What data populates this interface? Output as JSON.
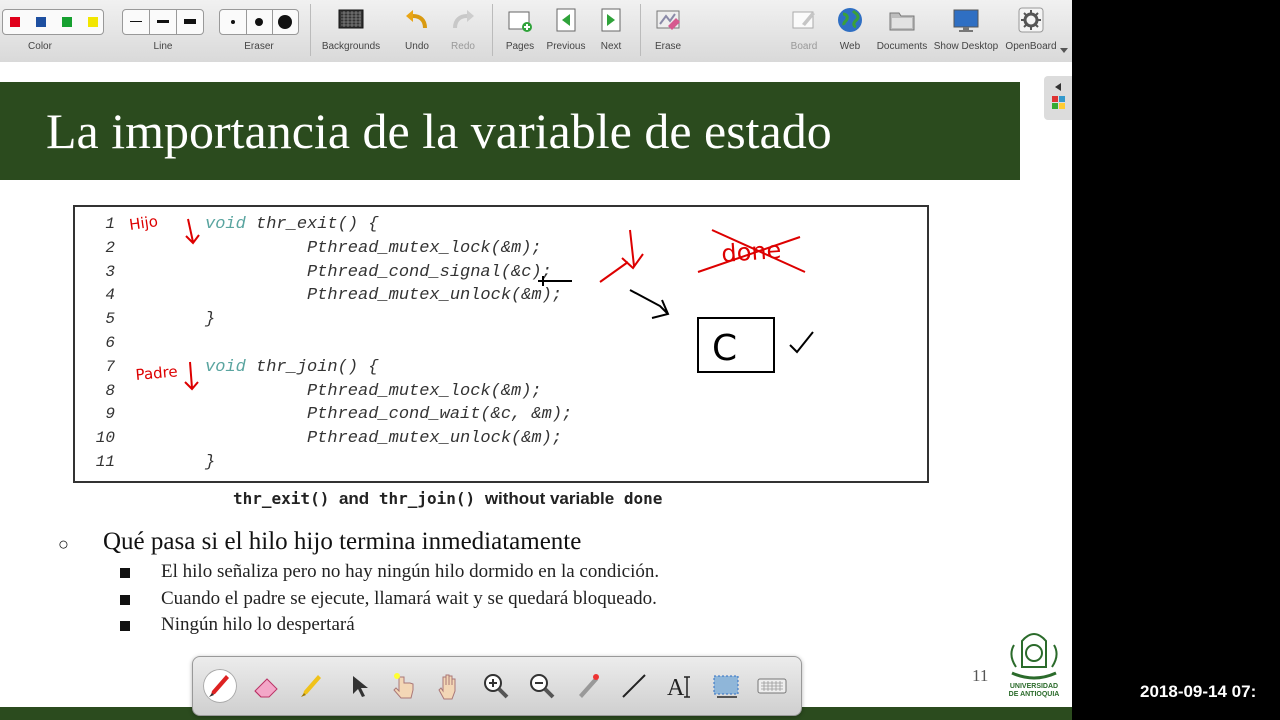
{
  "toolbar": {
    "color_label": "Color",
    "line_label": "Line",
    "eraser_label": "Eraser",
    "backgrounds_label": "Backgrounds",
    "undo_label": "Undo",
    "redo_label": "Redo",
    "pages_label": "Pages",
    "previous_label": "Previous",
    "next_label": "Next",
    "erase_label": "Erase",
    "board_label": "Board",
    "web_label": "Web",
    "documents_label": "Documents",
    "show_desktop_label": "Show Desktop",
    "openboard_label": "OpenBoard",
    "colors": [
      "#e0001b",
      "#1d4fa0",
      "#16a030",
      "#f2e600"
    ]
  },
  "slide": {
    "title": "La importancia de la variable de estado",
    "code": [
      {
        "n": "1",
        "kw": "void",
        "rest": " thr_exit() {"
      },
      {
        "n": "2",
        "kw": "",
        "rest": "Pthread_mutex_lock(&m);"
      },
      {
        "n": "3",
        "kw": "",
        "rest": "Pthread_cond_signal(&c);"
      },
      {
        "n": "4",
        "kw": "",
        "rest": "Pthread_mutex_unlock(&m);"
      },
      {
        "n": "5",
        "kw": "",
        "rest": "}"
      },
      {
        "n": "6",
        "kw": "",
        "rest": ""
      },
      {
        "n": "7",
        "kw": "void",
        "rest": " thr_join() {"
      },
      {
        "n": "8",
        "kw": "",
        "rest": "Pthread_mutex_lock(&m);"
      },
      {
        "n": "9",
        "kw": "",
        "rest": "Pthread_cond_wait(&c, &m);"
      },
      {
        "n": "10",
        "kw": "",
        "rest": "Pthread_mutex_unlock(&m);"
      },
      {
        "n": "11",
        "kw": "",
        "rest": "}"
      }
    ],
    "caption_a": "thr_exit()",
    "caption_and": "and",
    "caption_b": "thr_join()",
    "caption_c": "without variable",
    "caption_d": "done",
    "annotations": {
      "hijo": "Hijo",
      "padre": "Padre",
      "done": "done",
      "c": "C"
    },
    "bullet_main": "Qué pasa si el hilo hijo termina inmediatamente",
    "sub_bullets": [
      "El hilo señaliza pero no hay ningún hilo dormido en la condición.",
      "Cuando el padre se ejecute, llamará wait y se quedará bloqueado.",
      "Ningún hilo lo despertará"
    ],
    "page_number": "11",
    "logo_text_1": "UNIVERSIDAD",
    "logo_text_2": "DE ANTIOQUIA"
  },
  "datetime": "2018-09-14 07:",
  "accent": "#2b4b1e"
}
